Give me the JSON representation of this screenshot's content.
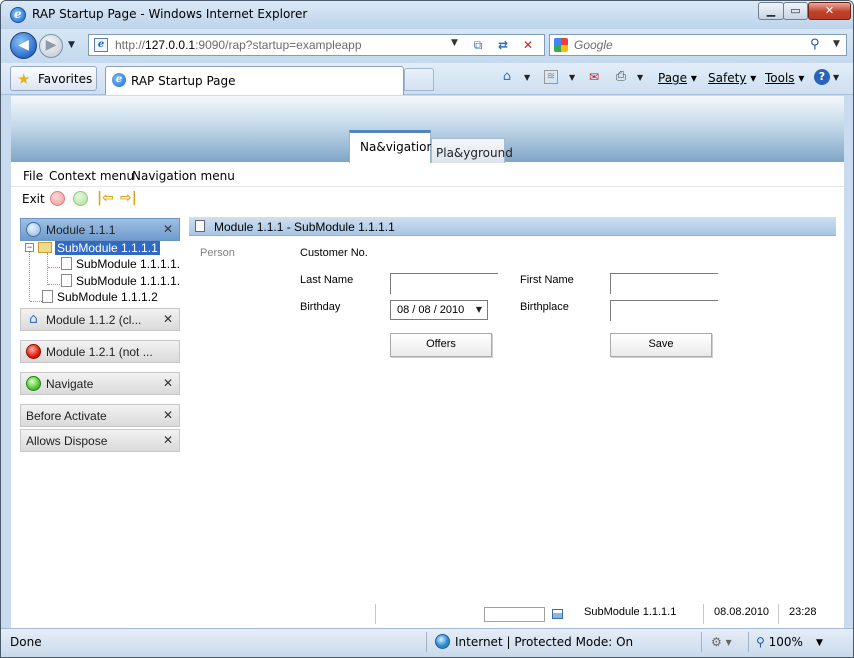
{
  "window": {
    "title": "RAP Startup Page - Windows Internet Explorer"
  },
  "address_bar": {
    "url_prefix": "http://",
    "url_host": "127.0.0.1",
    "url_rest": ":9090/rap?startup=exampleapp"
  },
  "search": {
    "placeholder": "Google"
  },
  "command_bar": {
    "favorites_label": "Favorites",
    "tab_title": "RAP Startup Page",
    "page_label": "Page",
    "safety_label": "Safety",
    "tools_label": "Tools"
  },
  "app": {
    "tabs": [
      {
        "label": "Na&vigation",
        "active": true
      },
      {
        "label": "Pla&yground",
        "active": false
      }
    ],
    "menu": [
      "File",
      "Context menu",
      "Navigation menu"
    ],
    "toolbar": {
      "exit_label": "Exit"
    },
    "modules": [
      {
        "label": "Module 1.1.1",
        "icon": "module-icon",
        "closable": true,
        "active": true
      },
      {
        "label": "Module 1.1.2 (cl...",
        "icon": "home-icon",
        "closable": true,
        "active": false
      },
      {
        "label": "Module 1.2.1 (not ...",
        "icon": "red-ball-icon",
        "closable": false,
        "active": false
      },
      {
        "label": "Navigate",
        "icon": "green-ball-icon",
        "closable": true,
        "active": false
      },
      {
        "label": "Before Activate",
        "icon": "",
        "closable": true,
        "active": false
      },
      {
        "label": "Allows Dispose",
        "icon": "",
        "closable": true,
        "active": false
      }
    ],
    "tree": [
      {
        "label": "SubModule 1.1.1.1",
        "selected": true
      },
      {
        "label": "SubModule 1.1.1.1.",
        "selected": false
      },
      {
        "label": "SubModule 1.1.1.1.",
        "selected": false
      },
      {
        "label": "SubModule 1.1.1.2",
        "selected": false
      }
    ],
    "form": {
      "header": "Module 1.1.1 - SubModule 1.1.1.1",
      "section_label": "Person",
      "customer_no_label": "Customer No.",
      "last_name_label": "Last Name",
      "last_name_value": "",
      "first_name_label": "First Name",
      "first_name_value": "",
      "birthday_label": "Birthday",
      "birthday_value": "08 / 08 / 2010",
      "birthplace_label": "Birthplace",
      "birthplace_value": "",
      "offers_button": "Offers",
      "save_button": "Save"
    },
    "status": {
      "submodule": "SubModule 1.1.1.1",
      "date": "08.08.2010",
      "time": "23:28"
    }
  },
  "ie_status": {
    "left_text": "Done",
    "zone_text": "Internet | Protected Mode: On",
    "zoom": "100%"
  },
  "colors": {
    "accent": "#316ac5",
    "active_module": "#6d9bcd",
    "tab_accent": "#4f86c0"
  }
}
